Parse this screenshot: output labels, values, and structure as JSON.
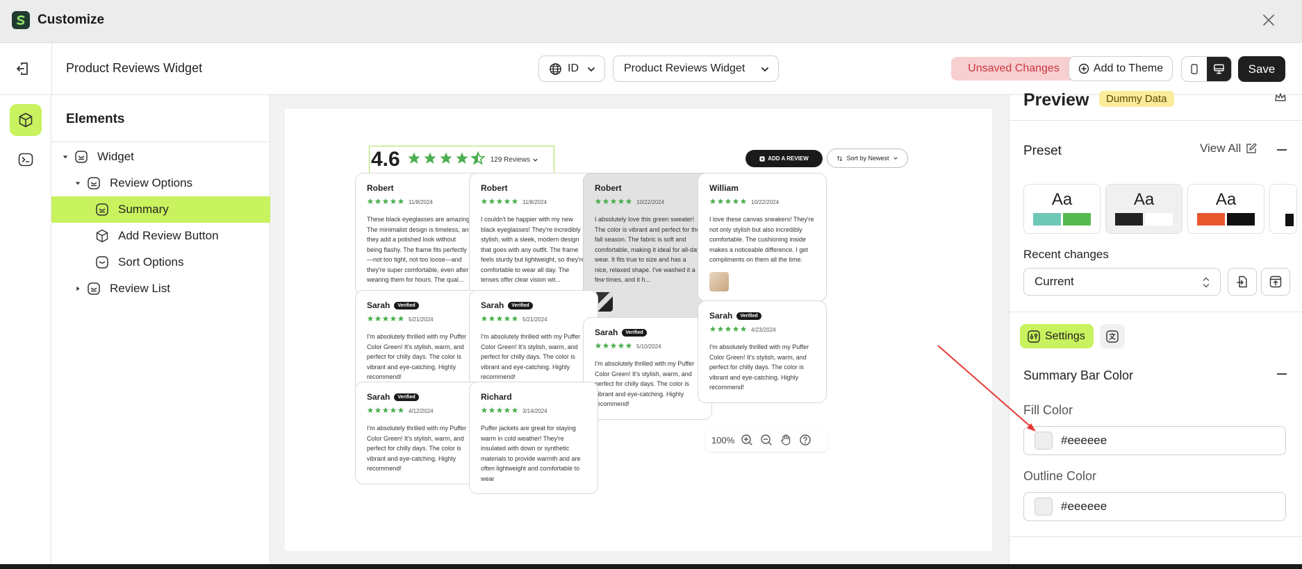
{
  "window": {
    "title": "Customize"
  },
  "toolbar": {
    "page_name": "Product Reviews Widget",
    "language": "ID",
    "widget_select": "Product Reviews Widget",
    "unsaved_label": "Unsaved Changes",
    "add_theme_label": "Add to Theme",
    "save_label": "Save"
  },
  "tree": {
    "header": "Elements",
    "items": [
      {
        "label": "Widget",
        "level": 0,
        "expanded": true
      },
      {
        "label": "Review Options",
        "level": 1,
        "expanded": true
      },
      {
        "label": "Summary",
        "level": 2,
        "selected": true
      },
      {
        "label": "Add Review Button",
        "level": 2
      },
      {
        "label": "Sort Options",
        "level": 2
      },
      {
        "label": "Review List",
        "level": 1,
        "expanded": false
      }
    ]
  },
  "canvas": {
    "rating": "4.6",
    "stars_filled": 4.5,
    "review_count": "129 Reviews",
    "add_review": "ADD A REVIEW",
    "sort_label": "Sort by Newest",
    "verified_label": "Verified",
    "zoom": "100%",
    "reviews": [
      {
        "name": "Robert",
        "date": "11/8/2024",
        "verified": false,
        "text": "These black eyeglasses are amazing! The minimalist design is timeless, and they add a polished look without being flashy. The frame fits perfectly—not too tight, not too loose—and they're super comfortable, even after wearing them for hours. The qual..."
      },
      {
        "name": "Robert",
        "date": "11/8/2024",
        "verified": false,
        "text": "I couldn't be happier with my new black eyeglasses! They're incredibly stylish, with a sleek, modern design that goes with any outfit. The frame feels sturdy but lightweight, so they're comfortable to wear all day. The lenses offer clear vision wit..."
      },
      {
        "name": "Robert",
        "date": "10/22/2024",
        "verified": false,
        "text": "I absolutely love this green sweater! The color is vibrant and perfect for the fall season. The fabric is soft and comfortable, making it ideal for all-day wear. It fits true to size and has a nice, relaxed shape. I've washed it a few times, and it h..."
      },
      {
        "name": "William",
        "date": "10/22/2024",
        "verified": false,
        "text": "I love these canvas sneakers! They're not only stylish but also incredibly comfortable. The cushioning inside makes a noticeable difference. I get compliments on them all the time."
      },
      {
        "name": "Sarah",
        "date": "5/21/2024",
        "verified": true,
        "text": "I'm absolutely thrilled with my Puffer Color Green! It's stylish, warm, and perfect for chilly days. The color is vibrant and eye-catching. Highly recommend!"
      },
      {
        "name": "Sarah",
        "date": "5/21/2024",
        "verified": true,
        "text": "I'm absolutely thrilled with my Puffer Color Green! It's stylish, warm, and perfect for chilly days. The color is vibrant and eye-catching. Highly recommend!"
      },
      {
        "name": "Sarah",
        "date": "5/10/2024",
        "verified": true,
        "text": "I'm absolutely thrilled with my Puffer Color Green! It's stylish, warm, and perfect for chilly days. The color is vibrant and eye-catching. Highly recommend!"
      },
      {
        "name": "Sarah",
        "date": "4/23/2024",
        "verified": true,
        "text": "I'm absolutely thrilled with my Puffer Color Green! It's stylish, warm, and perfect for chilly days. The color is vibrant and eye-catching. Highly recommend!"
      },
      {
        "name": "Sarah",
        "date": "4/12/2024",
        "verified": true,
        "text": "I'm absolutely thrilled with my Puffer Color Green! It's stylish, warm, and perfect for chilly days. The color is vibrant and eye-catching. Highly recommend!"
      },
      {
        "name": "Richard",
        "date": "3/14/2024",
        "verified": false,
        "text": "Puffer jackets are great for staying warm in cold weather! They're insulated with down or synthetic materials to provide warmth and are often lightweight and comfortable to wear"
      }
    ]
  },
  "panel": {
    "preview_title": "Preview",
    "dummy_badge": "Dummy Data",
    "preset_title": "Preset",
    "view_all": "View All",
    "preset_sample": "Aa",
    "presets": [
      {
        "c1": "#6fc7b6",
        "c2": "#56b94f"
      },
      {
        "c1": "#222222",
        "c2": "#ffffff"
      },
      {
        "c1": "#e8582f",
        "c2": "#111111"
      }
    ],
    "recent_title": "Recent changes",
    "recent_value": "Current",
    "settings_tab": "Settings",
    "section_title": "Summary Bar Color",
    "fill_label": "Fill Color",
    "fill_value": "#eeeeee",
    "outline_label": "Outline Color",
    "outline_value": "#eeeeee"
  },
  "colors": {
    "accent": "#c8f25e",
    "star": "#4caf50",
    "unsaved_bg": "#f8cfd0",
    "unsaved_text": "#c8383f",
    "annotation": "#e53935"
  }
}
